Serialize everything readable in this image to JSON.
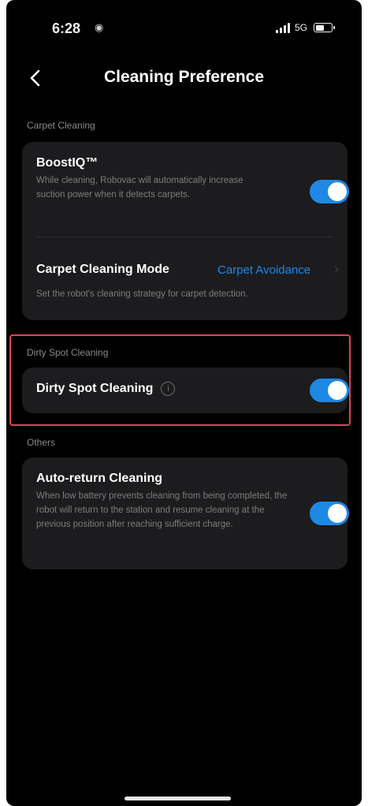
{
  "status": {
    "time": "6:28",
    "extra_icon": "lock-person-icon",
    "network": "5G",
    "battery_level_percent": 60
  },
  "nav": {
    "back_icon": "chevron-left-icon",
    "title": "Cleaning Preference"
  },
  "carpet_section": {
    "label": "Carpet Cleaning",
    "boostiq": {
      "title": "BoostIQ™",
      "description": "While cleaning, Robovac will automatically increase suction power when it detects carpets.",
      "enabled": true
    },
    "carpet_mode": {
      "title": "Carpet Cleaning Mode",
      "value": "Carpet Avoidance",
      "description": "Set the robot's cleaning strategy for carpet detection."
    }
  },
  "dirty_section": {
    "label": "Dirty Spot Cleaning",
    "toggle_title": "Dirty Spot Cleaning",
    "info_icon": "info-icon",
    "enabled": true
  },
  "others_section": {
    "label": "Others",
    "auto_return": {
      "title": "Auto-return Cleaning",
      "description": "When low battery prevents cleaning from being completed, the robot will return to the station and resume cleaning at the previous position after reaching sufficient charge.",
      "enabled": true
    }
  },
  "colors": {
    "background": "#000000",
    "card": "#1c1c1e",
    "accent": "#1e88e5",
    "highlight": "#e0455a",
    "muted_text": "#7d7d7d"
  }
}
